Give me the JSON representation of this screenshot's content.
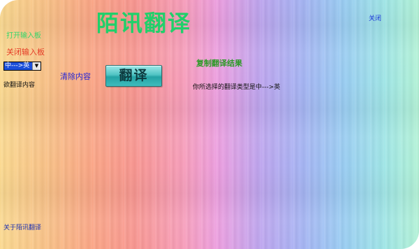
{
  "app": {
    "title": "陌讯翻译",
    "close_label": "关闭"
  },
  "sidebar": {
    "open_board_label": "打开输入板",
    "close_board_label": "关闭输入板",
    "language_select": {
      "selected": "中--->英",
      "options": [
        "中--->英"
      ]
    },
    "source_label": "欲翻译内容",
    "about_label": "关于陌讯翻译"
  },
  "toolbar": {
    "clear_label": "清除内容",
    "translate_label": "翻译",
    "copy_label": "复制翻译结果"
  },
  "result": {
    "selected_type_label": "你所选择的翻译类型是",
    "selected_type_value": "中--->英"
  }
}
